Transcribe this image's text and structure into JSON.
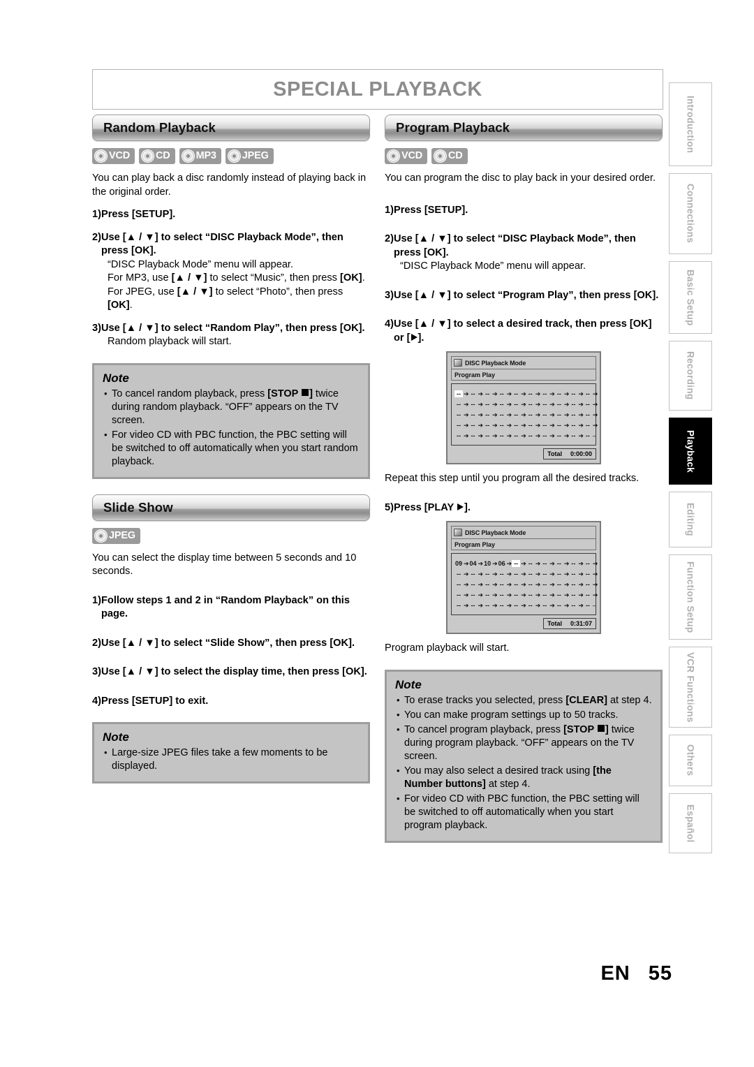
{
  "page": {
    "title": "SPECIAL PLAYBACK",
    "footer_lang": "EN",
    "footer_page": "55"
  },
  "sidebar": {
    "tabs": [
      {
        "label": "Introduction",
        "active": false
      },
      {
        "label": "Connections",
        "active": false
      },
      {
        "label": "Basic Setup",
        "active": false
      },
      {
        "label": "Recording",
        "active": false
      },
      {
        "label": "Playback",
        "active": true
      },
      {
        "label": "Editing",
        "active": false
      },
      {
        "label": "Function Setup",
        "active": false
      },
      {
        "label": "VCR Functions",
        "active": false
      },
      {
        "label": "Others",
        "active": false
      },
      {
        "label": "Español",
        "active": false
      }
    ]
  },
  "random_playback": {
    "heading": "Random Playback",
    "badges": [
      "VCD",
      "CD",
      "MP3",
      "JPEG"
    ],
    "intro": "You can play back a disc randomly instead of playing back in the original order.",
    "steps": [
      {
        "num": "1)",
        "text": "Press [SETUP]."
      },
      {
        "num": "2)",
        "text": "Use [▲ / ▼] to select “DISC Playback Mode”, then press [OK].",
        "subs": [
          "“DISC Playback Mode” menu will appear.",
          "For MP3, use [▲ / ▼] to select “Music”, then press [OK].",
          "For JPEG, use [▲ / ▼] to select “Photo”, then press [OK]."
        ]
      },
      {
        "num": "3)",
        "text": "Use [▲ / ▼] to select “Random Play”, then press [OK].",
        "subs": [
          "Random playback will start."
        ]
      }
    ],
    "note": {
      "title": "Note",
      "items": [
        "To cancel random playback, press [STOP ■] twice during random playback. “OFF” appears on the TV screen.",
        "For video CD with PBC function, the PBC setting will be switched to off automatically when you start random playback."
      ]
    }
  },
  "slide_show": {
    "heading": "Slide Show",
    "badges": [
      "JPEG"
    ],
    "intro": "You can select the display time between 5 seconds and 10 seconds.",
    "steps": [
      {
        "num": "1)",
        "text": "Follow steps 1 and 2 in “Random Playback” on this page."
      },
      {
        "num": "2)",
        "text": "Use [▲ / ▼] to select “Slide Show”, then press [OK]."
      },
      {
        "num": "3)",
        "text": "Use [▲ / ▼] to select the display time, then press [OK]."
      },
      {
        "num": "4)",
        "text": "Press [SETUP] to exit."
      }
    ],
    "note": {
      "title": "Note",
      "items": [
        "Large-size JPEG files take a few moments to be displayed."
      ]
    }
  },
  "program_playback": {
    "heading": "Program Playback",
    "badges": [
      "VCD",
      "CD"
    ],
    "intro": "You can program the disc to play back in your desired order.",
    "steps": [
      {
        "num": "1)",
        "text": "Press [SETUP]."
      },
      {
        "num": "2)",
        "text": "Use [▲ / ▼] to select “DISC Playback Mode”, then press [OK].",
        "subs": [
          "“DISC Playback Mode” menu will appear."
        ]
      },
      {
        "num": "3)",
        "text": "Use [▲ / ▼] to select “Program Play”, then press [OK]."
      },
      {
        "num": "4)",
        "text": "Use [▲ / ▼] to select a desired track, then press [OK] or [▶]."
      }
    ],
    "after_screen1": "Repeat this step until you program all the desired tracks.",
    "step5": {
      "num": "5)",
      "text": "Press [PLAY ▶]."
    },
    "after_screen2": "Program playback will start.",
    "note": {
      "title": "Note",
      "items": [
        "To erase tracks you selected, press [CLEAR] at step 4.",
        "You can make program settings up to 50 tracks.",
        "To cancel program playback, press [STOP ■] twice during program playback. “OFF” appears on the TV screen.",
        "You may also select a desired track using [the Number buttons] at step 4.",
        "For video CD with PBC function, the PBC setting will be switched to off automatically when you start program playback."
      ]
    },
    "screen_empty": {
      "title": "DISC Playback Mode",
      "subtitle": "Program Play",
      "total_label": "Total",
      "total_value": "0:00:00",
      "rows": [
        [
          "--",
          "--",
          "--",
          "--",
          "--",
          "--",
          "--",
          "--",
          "--",
          "--"
        ],
        [
          "--",
          "--",
          "--",
          "--",
          "--",
          "--",
          "--",
          "--",
          "--",
          "--"
        ],
        [
          "--",
          "--",
          "--",
          "--",
          "--",
          "--",
          "--",
          "--",
          "--",
          "--"
        ],
        [
          "--",
          "--",
          "--",
          "--",
          "--",
          "--",
          "--",
          "--",
          "--",
          "--"
        ],
        [
          "--",
          "--",
          "--",
          "--",
          "--",
          "--",
          "--",
          "--",
          "--",
          "--"
        ]
      ],
      "highlight_index": 0
    },
    "screen_programmed": {
      "title": "DISC Playback Mode",
      "subtitle": "Program Play",
      "total_label": "Total",
      "total_value": "0:31:07",
      "rows": [
        [
          "09",
          "04",
          "10",
          "06",
          "--",
          "--",
          "--",
          "--",
          "--",
          "--"
        ],
        [
          "--",
          "--",
          "--",
          "--",
          "--",
          "--",
          "--",
          "--",
          "--",
          "--"
        ],
        [
          "--",
          "--",
          "--",
          "--",
          "--",
          "--",
          "--",
          "--",
          "--",
          "--"
        ],
        [
          "--",
          "--",
          "--",
          "--",
          "--",
          "--",
          "--",
          "--",
          "--",
          "--"
        ],
        [
          "--",
          "--",
          "--",
          "--",
          "--",
          "--",
          "--",
          "--",
          "--",
          "--"
        ]
      ],
      "highlight_index": 4
    }
  },
  "colors": {
    "note_bg": "#c4c4c4",
    "note_border": "#9d9d9d",
    "badge_bg": "#9a9a9a",
    "title_gray": "#8c8c8c",
    "tab_inactive_text": "#b0b0b0",
    "tab_active_bg": "#000000"
  }
}
